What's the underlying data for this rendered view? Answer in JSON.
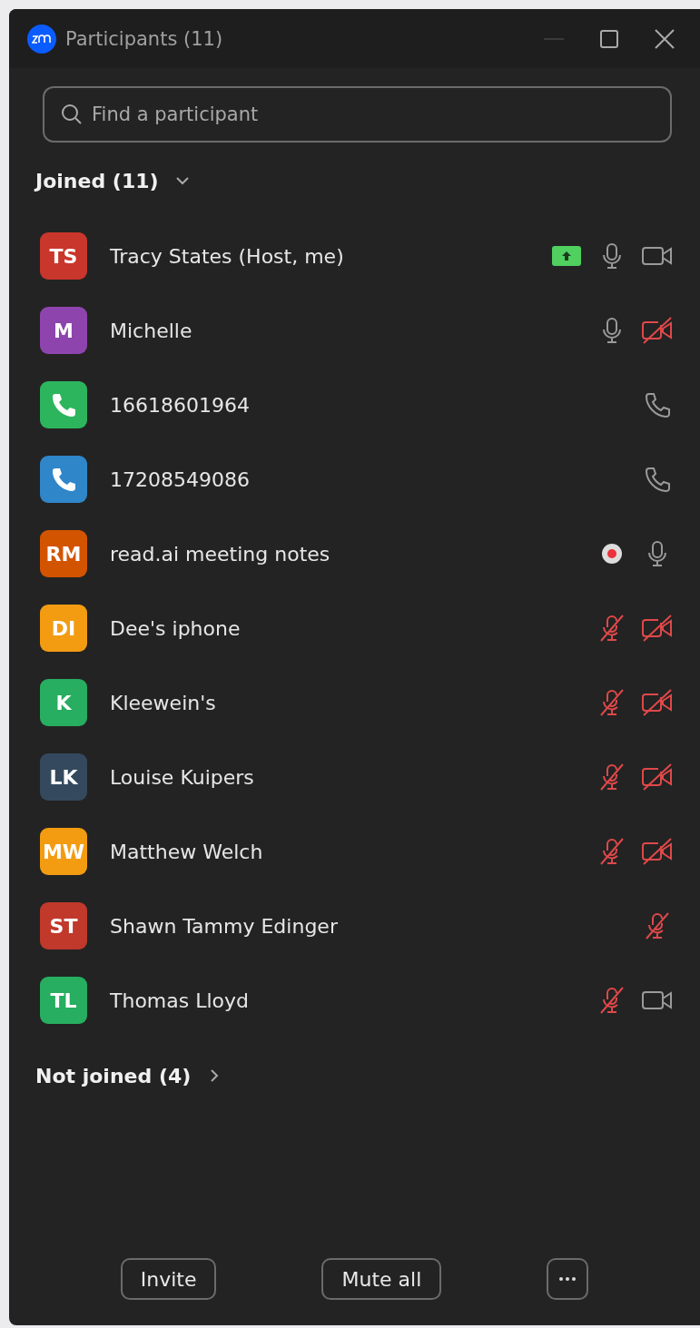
{
  "window": {
    "title": "Participants (11)"
  },
  "search": {
    "placeholder": "Find a participant"
  },
  "joined": {
    "label": "Joined (11)",
    "expanded": true
  },
  "participants": [
    {
      "kind": "initials",
      "initials": "TS",
      "color": "#c9362b",
      "name": "Tracy States (Host, me)",
      "icons": [
        {
          "kind": "share"
        },
        {
          "kind": "mic"
        },
        {
          "kind": "video"
        }
      ]
    },
    {
      "kind": "initials",
      "initials": "M",
      "color": "#8e44ad",
      "name": "Michelle",
      "icons": [
        {
          "kind": "mic"
        },
        {
          "kind": "video-off"
        }
      ]
    },
    {
      "kind": "phone",
      "color": "#2db55d",
      "name": "16618601964",
      "icons": [
        {
          "kind": "phone"
        }
      ]
    },
    {
      "kind": "phone",
      "color": "#2f86c9",
      "name": "17208549086",
      "icons": [
        {
          "kind": "phone"
        }
      ]
    },
    {
      "kind": "initials",
      "initials": "RM",
      "color": "#d35400",
      "name": "read.ai meeting notes",
      "icons": [
        {
          "kind": "recording"
        },
        {
          "kind": "mic"
        }
      ]
    },
    {
      "kind": "initials",
      "initials": "DI",
      "color": "#f39c12",
      "name": "Dee's iphone",
      "icons": [
        {
          "kind": "mic-muted"
        },
        {
          "kind": "video-off"
        }
      ]
    },
    {
      "kind": "initials",
      "initials": "K",
      "color": "#27ae60",
      "name": "Kleewein's",
      "icons": [
        {
          "kind": "mic-muted"
        },
        {
          "kind": "video-off"
        }
      ]
    },
    {
      "kind": "initials",
      "initials": "LK",
      "color": "#34495e",
      "name": "Louise Kuipers",
      "icons": [
        {
          "kind": "mic-muted"
        },
        {
          "kind": "video-off"
        }
      ]
    },
    {
      "kind": "initials",
      "initials": "MW",
      "color": "#f39c12",
      "name": "Matthew Welch",
      "icons": [
        {
          "kind": "mic-muted"
        },
        {
          "kind": "video-off"
        }
      ]
    },
    {
      "kind": "initials",
      "initials": "ST",
      "color": "#c0392b",
      "name": "Shawn Tammy Edinger",
      "icons": [
        {
          "kind": "mic-muted"
        }
      ]
    },
    {
      "kind": "initials",
      "initials": "TL",
      "color": "#27ae60",
      "name": "Thomas Lloyd",
      "icons": [
        {
          "kind": "mic-muted"
        },
        {
          "kind": "video"
        }
      ]
    }
  ],
  "not_joined": {
    "label": "Not joined (4)",
    "expanded": false
  },
  "buttons": [
    {
      "kind": "text",
      "label": "Invite"
    },
    {
      "kind": "text",
      "label": "Mute all"
    },
    {
      "kind": "more"
    }
  ]
}
